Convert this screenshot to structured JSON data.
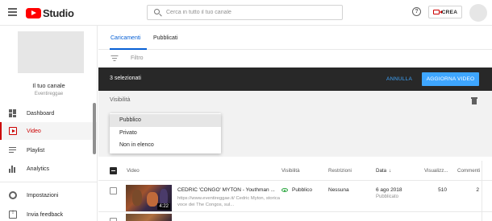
{
  "header": {
    "logo_text": "Studio",
    "search_placeholder": "Cerca in tutto il tuo canale",
    "help_icon": "help-icon",
    "create_label": "CREA",
    "create_icon": "camera-icon"
  },
  "sidebar": {
    "channel_name": "Il tuo canale",
    "channel_handle": "Eventireggae",
    "items": [
      {
        "label": "Dashboard",
        "icon": "dashboard-icon"
      },
      {
        "label": "Video",
        "icon": "video-icon",
        "active": true
      },
      {
        "label": "Playlist",
        "icon": "playlist-icon"
      },
      {
        "label": "Analytics",
        "icon": "analytics-icon"
      },
      {
        "label": "Impostazioni",
        "icon": "gear-icon"
      },
      {
        "label": "Invia feedback",
        "icon": "feedback-icon"
      }
    ]
  },
  "tabs": [
    {
      "label": "Caricamenti",
      "active": true
    },
    {
      "label": "Pubblicati"
    }
  ],
  "filter": {
    "placeholder": "Filtro",
    "icon": "filter-icon"
  },
  "selection_bar": {
    "count_label": "3 selezionati",
    "cancel_label": "ANNULLA",
    "update_label": "AGGIORNA VIDEO"
  },
  "edit_panel": {
    "field_label": "Visibilità",
    "delete_icon": "trash-icon",
    "visibility_options": [
      "Pubblico",
      "Privato",
      "Non in elenco"
    ],
    "highlighted_option": "Pubblico"
  },
  "table": {
    "columns": [
      "Video",
      "Visibilità",
      "Restrizioni",
      "Data",
      "Visualizz...",
      "Commenti"
    ],
    "sort_column": "Data",
    "rows": [
      {
        "title": "CEDRIC 'CONGO' MYTON - Youthman ...",
        "description": "https://www.eventireggae.it/ Cedric Myton, storica voce dei The Congos, sul...",
        "duration": "4:22",
        "visibility": "Pubblico",
        "restrictions": "Nessuna",
        "date": "6 ago 2018",
        "date_status": "Pubblicato",
        "views": "510",
        "comments": "2"
      }
    ]
  },
  "colors": {
    "accent_red": "#cc0000",
    "link_blue": "#065fd4",
    "button_blue": "#3ea6ff",
    "selection_bar": "#282828",
    "public_green": "#2ba640"
  }
}
